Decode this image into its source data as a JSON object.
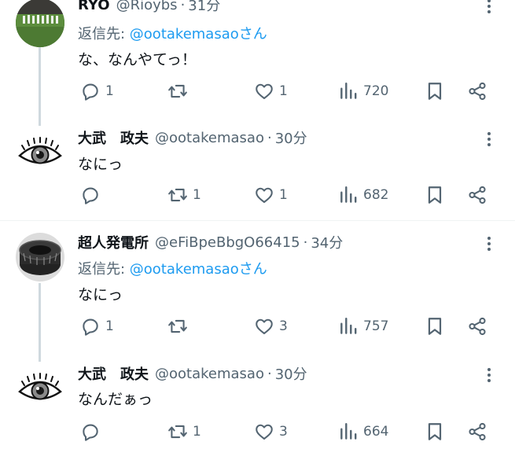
{
  "tweets": [
    {
      "name": "RYO",
      "handle": "@Rioybs",
      "time": "31分",
      "reply_prefix": "返信先: ",
      "reply_to": "@ootakemasaoさん",
      "text": "な、なんやてっ！",
      "replies": "1",
      "retweets": "",
      "likes": "1",
      "views": "720",
      "avatar": "stadium-photo"
    },
    {
      "name": "大武　政夫",
      "handle": "@ootakemasao",
      "time": "30分",
      "reply_prefix": "",
      "reply_to": "",
      "text": "なにっ",
      "replies": "",
      "retweets": "1",
      "likes": "1",
      "views": "682",
      "avatar": "eye-drawing"
    },
    {
      "name": "超人発電所",
      "handle": "@eFiBpeBbgO66415",
      "time": "34分",
      "reply_prefix": "返信先: ",
      "reply_to": "@ootakemasaoさん",
      "text": "なにっ",
      "replies": "1",
      "retweets": "",
      "likes": "3",
      "views": "757",
      "avatar": "ring-object"
    },
    {
      "name": "大武　政夫",
      "handle": "@ootakemasao",
      "time": "30分",
      "reply_prefix": "",
      "reply_to": "",
      "text": "なんだぁっ",
      "replies": "",
      "retweets": "1",
      "likes": "3",
      "views": "664",
      "avatar": "eye-drawing"
    }
  ],
  "icons": {
    "reply": "speech-bubble-icon",
    "retweet": "retweet-icon",
    "like": "heart-icon",
    "views": "bar-chart-icon",
    "bookmark": "bookmark-icon",
    "share": "share-icon",
    "more": "more-icon"
  },
  "colors": {
    "text": "#0f1419",
    "secondary": "#536471",
    "link": "#1d9bf0",
    "thread_line": "#cfd9de"
  }
}
